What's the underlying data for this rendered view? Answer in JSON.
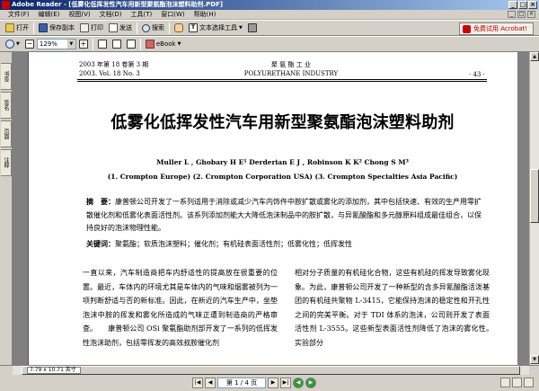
{
  "window": {
    "title": "Adobe Reader - [低雾化低挥发性汽车用新型聚氨酯泡沫塑料助剂.PDF]",
    "min": "_",
    "max": "□",
    "close": "×"
  },
  "menu": [
    "文件(F)",
    "编辑(E)",
    "视图(V)",
    "文档(D)",
    "工具(T)",
    "窗口(W)",
    "帮助(H)"
  ],
  "toolbar1": {
    "open": "打开",
    "save_copy": "保存副本",
    "print": "打印",
    "send": "发送",
    "search": "搜索",
    "text_tool": "文本选择工具",
    "acrobat": "免费试用 Acrobat!"
  },
  "toolbar2": {
    "zoom": "129%",
    "ebook": "eBook"
  },
  "nav_tabs": [
    "书签",
    "签名",
    "页面",
    "注释"
  ],
  "page": {
    "header_left_1": "2003 年第 18 卷第 3 期",
    "header_left_2": "2003. Vol. 18 No. 3",
    "header_center_1": "聚 氨 酯 工 业",
    "header_center_2": "POLYURETHANE INDUSTRY",
    "page_no": "· 43 ·",
    "title": "低雾化低挥发性汽车用新型聚氨酯泡沫塑料助剂",
    "authors": "Muller L , Ghobary H E¹   Derderian E J , Robinson K K²   Chong S M³",
    "affiliations": "(1. Crompton Europe)  (2. Crompton Corporation USA)  (3. Crompton Specialties Asia Pacific)",
    "abstract_label": "摘　要：",
    "abstract_text": "康普顿公司开发了一系列适用于消除或减少汽车内饰件中胺扩散或雾化的添加剂，其中包括快速、有效的生产用零扩散催化剂和低雾化表面活性剂。该系列添加剂能大大降低泡沫制品中的胺扩散，与异氰酸酯和多元醇原料组成最佳组合，以保持良好的泡沫物理性能。",
    "keywords_label": "关键词：",
    "keywords_text": "聚氨酯；软质泡沫塑料；催化剂；有机硅表面活性剂；低雾化性；低挥发性",
    "col_left": "一直以来，汽车制造商把车内舒适性的提高放在很重要的位置。最近，车体内的环境尤其是车体内的气味和烟雾被列为一项判断舒适与否的新标准。因此，在新近的汽车生产中，坐垫泡沫中胺的挥发和雾化所造成的气味正遭到制造商的严格审查。　　康普顿公司 OSi 聚氨酯助剂部开发了一系列的低挥发性泡沫助剂，包括零挥发的高效叔胺催化剂",
    "col_right": "相对分子质量的有机硅化合物，这些有机硅的挥发导致雾化现象。为此，康普顿公司开发了一种新型的含多异氰酸酯活泼基团的有机硅共聚物 L-3415，它能保持泡沫的稳定性和开孔性之间的完美平衡。对于 TDI 体系的泡沫，公司则开发了表面活性剂 L-3555。这些新型表面活性剂降低了泡沫的雾化性。　　实验部分"
  },
  "status": {
    "page_size": "7.79 x 10.71 英寸",
    "page_indicator": "第 1 / 4 页"
  }
}
